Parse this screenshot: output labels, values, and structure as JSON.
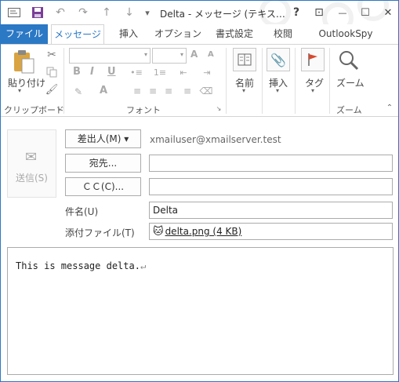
{
  "title": {
    "text": "Delta - メッセージ (テキス…",
    "help": "?",
    "ribbon_display": "⊡",
    "minimize": "—",
    "maximize": "☐",
    "close": "✕"
  },
  "quick_access": {
    "undo_icon": "↶",
    "redo_icon": "↷",
    "up_icon": "↑",
    "down_icon": "↓",
    "customize_icon": "▾"
  },
  "tabs": [
    {
      "label": "ファイル"
    },
    {
      "label": "メッセージ"
    },
    {
      "label": "挿入"
    },
    {
      "label": "オプション"
    },
    {
      "label": "書式設定"
    },
    {
      "label": "校閲"
    },
    {
      "label": "OutlookSpy"
    }
  ],
  "ribbon": {
    "clipboard": {
      "paste_label": "貼り付け",
      "group_label": "クリップボード"
    },
    "font": {
      "group_label": "フォント",
      "bold": "B",
      "italic": "I",
      "underline": "U",
      "font_color": "A",
      "grow": "A",
      "shrink": "A"
    },
    "names": {
      "label": "名前"
    },
    "insert": {
      "label": "挿入"
    },
    "tags": {
      "label": "タグ"
    },
    "zoom": {
      "label": "ズーム",
      "group_label": "ズーム"
    }
  },
  "compose": {
    "send_label": "送信(S)",
    "from_button": "差出人(M) ▾",
    "from_address": "xmailuser@xmailserver.test",
    "to_button": "宛先...",
    "to_value": "",
    "cc_button": "ＣＣ(C)...",
    "cc_value": "",
    "subject_label": "件名(U)",
    "subject_value": "Delta",
    "attach_label": "添付ファイル(T)",
    "attachment": "delta.png (4 KB)",
    "body": "This is message delta.",
    "return_mark": "↵"
  }
}
